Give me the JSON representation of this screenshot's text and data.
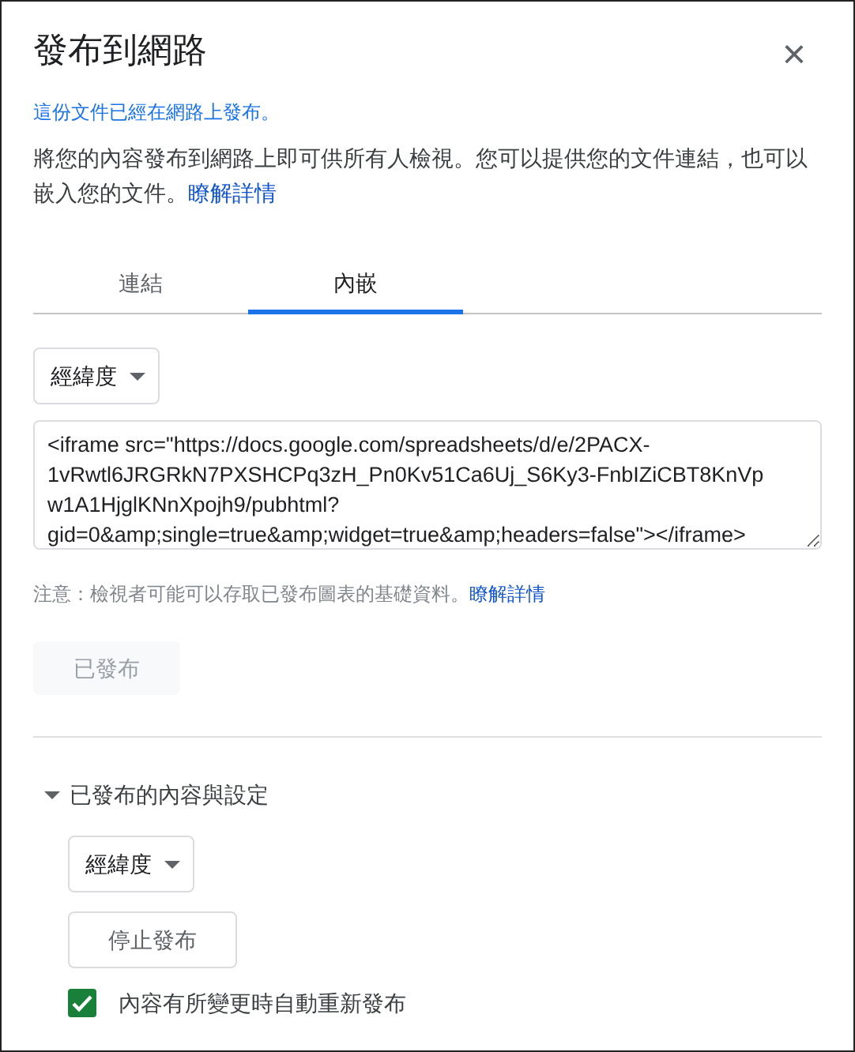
{
  "dialog": {
    "title": "發布到網路",
    "close_icon": "×"
  },
  "status_link": "這份文件已經在網路上發布。",
  "description": {
    "text": "將您的內容發布到網路上即可供所有人檢視。您可以提供您的文件連結，也可以嵌入您的文件。",
    "link": "瞭解詳情"
  },
  "tabs": [
    {
      "label": "連結",
      "selected": false
    },
    {
      "label": "內嵌",
      "selected": true
    }
  ],
  "format_dropdown": {
    "value": "經緯度"
  },
  "embed_code": "<iframe src=\"https://docs.google.com/spreadsheets/d/e/2PACX-1vRwtl6JRGRkN7PXSHCPq3zH_Pn0Kv51Ca6Uj_S6Ky3-FnbIZiCBT8KnVp            w1A1HjglKNnXpojh9/pubhtml?gid=0&amp;single=true&amp;widget=true&amp;headers=false\"></iframe>",
  "note": {
    "text": "注意：檢視者可能可以存取已發布圖表的基礎資料。",
    "link": "瞭解詳情"
  },
  "publish_button": {
    "label": "已發布",
    "disabled": true
  },
  "section": {
    "label": "已發布的內容與設定",
    "expanded": true,
    "dropdown": {
      "value": "經緯度"
    },
    "stop_button": {
      "label": "停止發布"
    },
    "auto_republish": {
      "label": "內容有所變更時自動重新發布",
      "checked": true
    }
  }
}
